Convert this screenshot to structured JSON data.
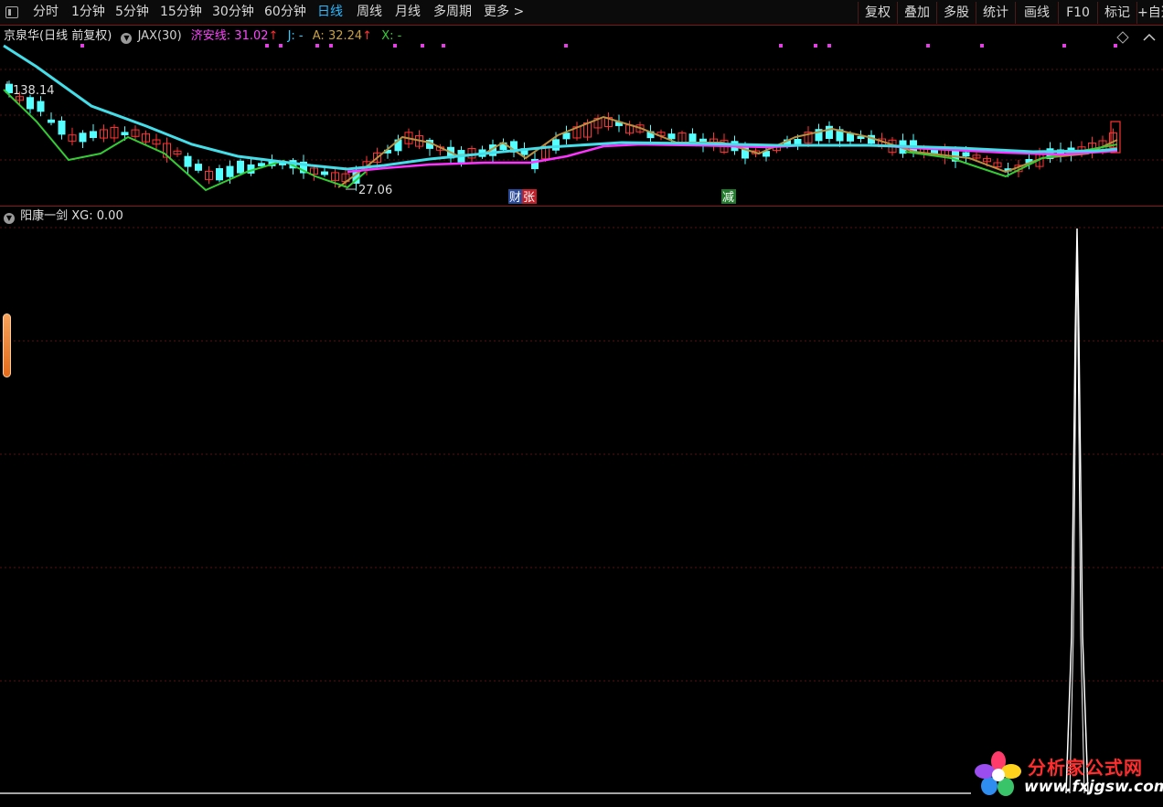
{
  "toolbar": {
    "periods": [
      "分时",
      "1分钟",
      "5分钟",
      "15分钟",
      "30分钟",
      "60分钟",
      "日线",
      "周线",
      "月线",
      "多周期",
      "更多 >"
    ],
    "active_period": "日线",
    "right_buttons": [
      "复权",
      "叠加",
      "多股",
      "统计",
      "画线",
      "F10",
      "标记",
      "+自选"
    ]
  },
  "price_panel": {
    "stock_title": "京泉华(日线 前复权)",
    "indicator_name": "JAX(30)",
    "jax_label": "济安线: 31.02",
    "j_label": "J: -",
    "a_label": "A: 32.24",
    "x_label": "X: -",
    "high_label": "138.14",
    "low_label": "27.06",
    "tag_cai": "财",
    "tag_zhang": "张",
    "tag_jian": "减",
    "colors": {
      "jax": "#ff33ff",
      "j": "#33ccff",
      "a": "#c8a040",
      "x": "#33cc33",
      "up": "#ff3333",
      "down": "#55ffff"
    }
  },
  "indicator_panel": {
    "title": "阳康一剑 XG: 0.00"
  },
  "watermark": {
    "title": "分析家公式网",
    "url": "www.fxjgsw.com",
    "icon": "flower-logo-icon"
  }
}
